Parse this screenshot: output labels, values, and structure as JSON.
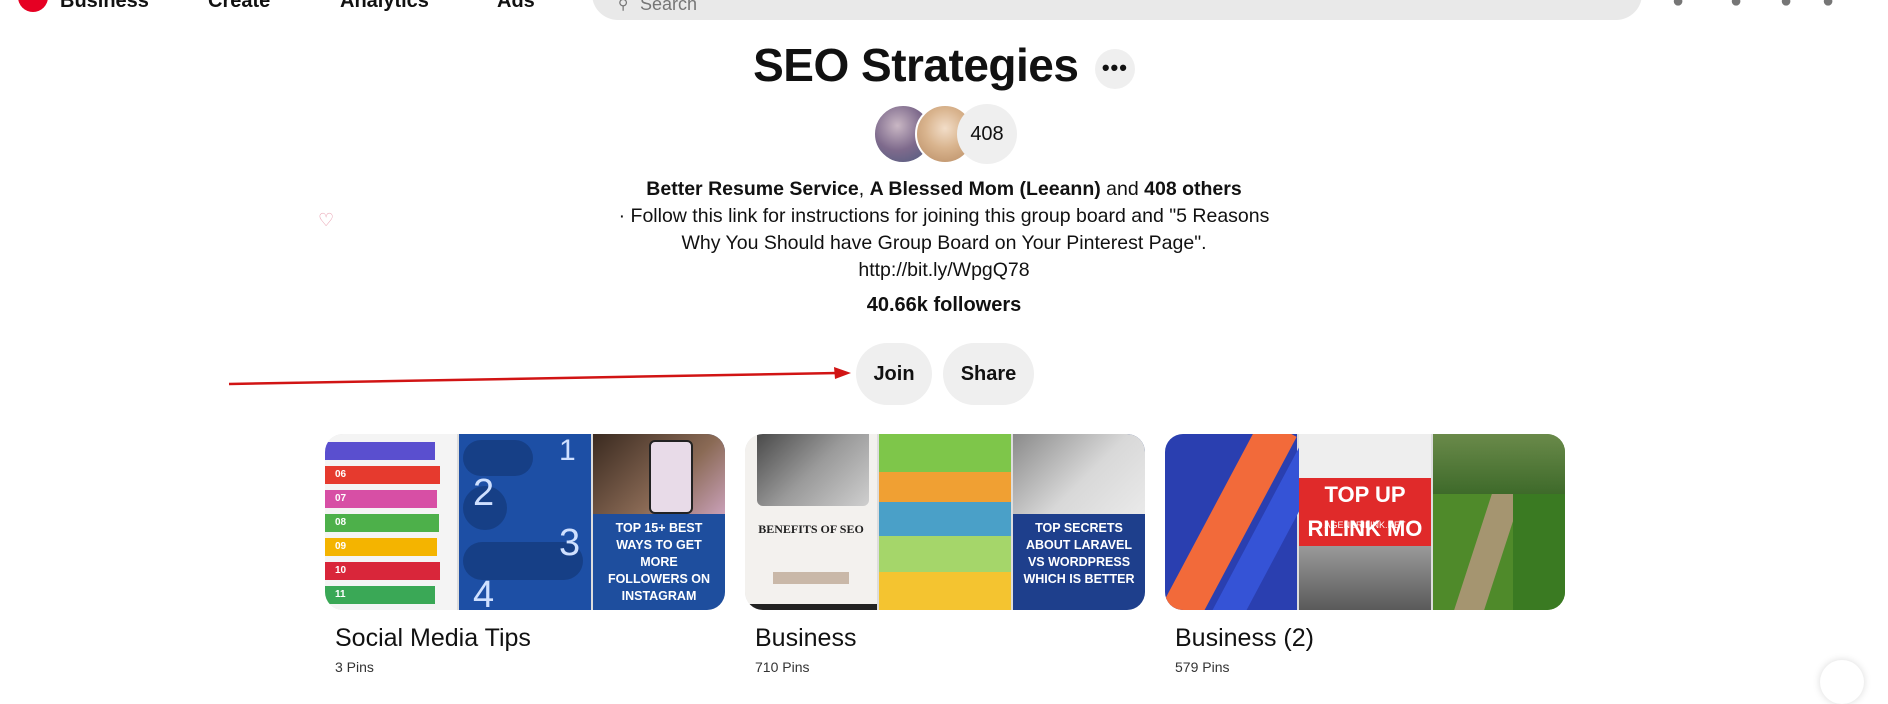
{
  "nav": {
    "business": "Business",
    "create": "Create",
    "analytics": "Analytics",
    "ads": "Ads",
    "search_placeholder": "Search",
    "brand_color": "#e60023"
  },
  "board": {
    "title": "SEO Strategies",
    "more_icon": "ellipsis-icon",
    "collaborator_count": "408",
    "collab_1": "Better Resume Service",
    "collab_sep": ", ",
    "collab_2": "A Blessed Mom (Leeann)",
    "and": " and ",
    "others": "408 others",
    "description": "· Follow this link for instructions for joining this group board and \"5 Reasons Why You Should have Group Board on Your Pinterest Page\". http://bit.ly/WpgQ78",
    "followers": "40.66k followers",
    "join_label": "Join",
    "share_label": "Share",
    "annotation_color": "#d11414"
  },
  "boards": [
    {
      "name": "Social Media Tips",
      "pins": "3 Pins",
      "cover_3_text": "TOP 15+ BEST WAYS TO GET MORE FOLLOWERS ON INSTAGRAM"
    },
    {
      "name": "Business",
      "pins": "710 Pins",
      "cover_1_text": "BENEFITS OF SEO",
      "cover_3_text": "TOP SECRETS ABOUT LARAVEL VS WORDPRESS WHICH IS BETTER"
    },
    {
      "name": "Business (2)",
      "pins": "579 Pins",
      "cover_2_text": "TOP UP RILINK MO",
      "cover_2_sub": "AGENBRILINK.NET"
    }
  ]
}
